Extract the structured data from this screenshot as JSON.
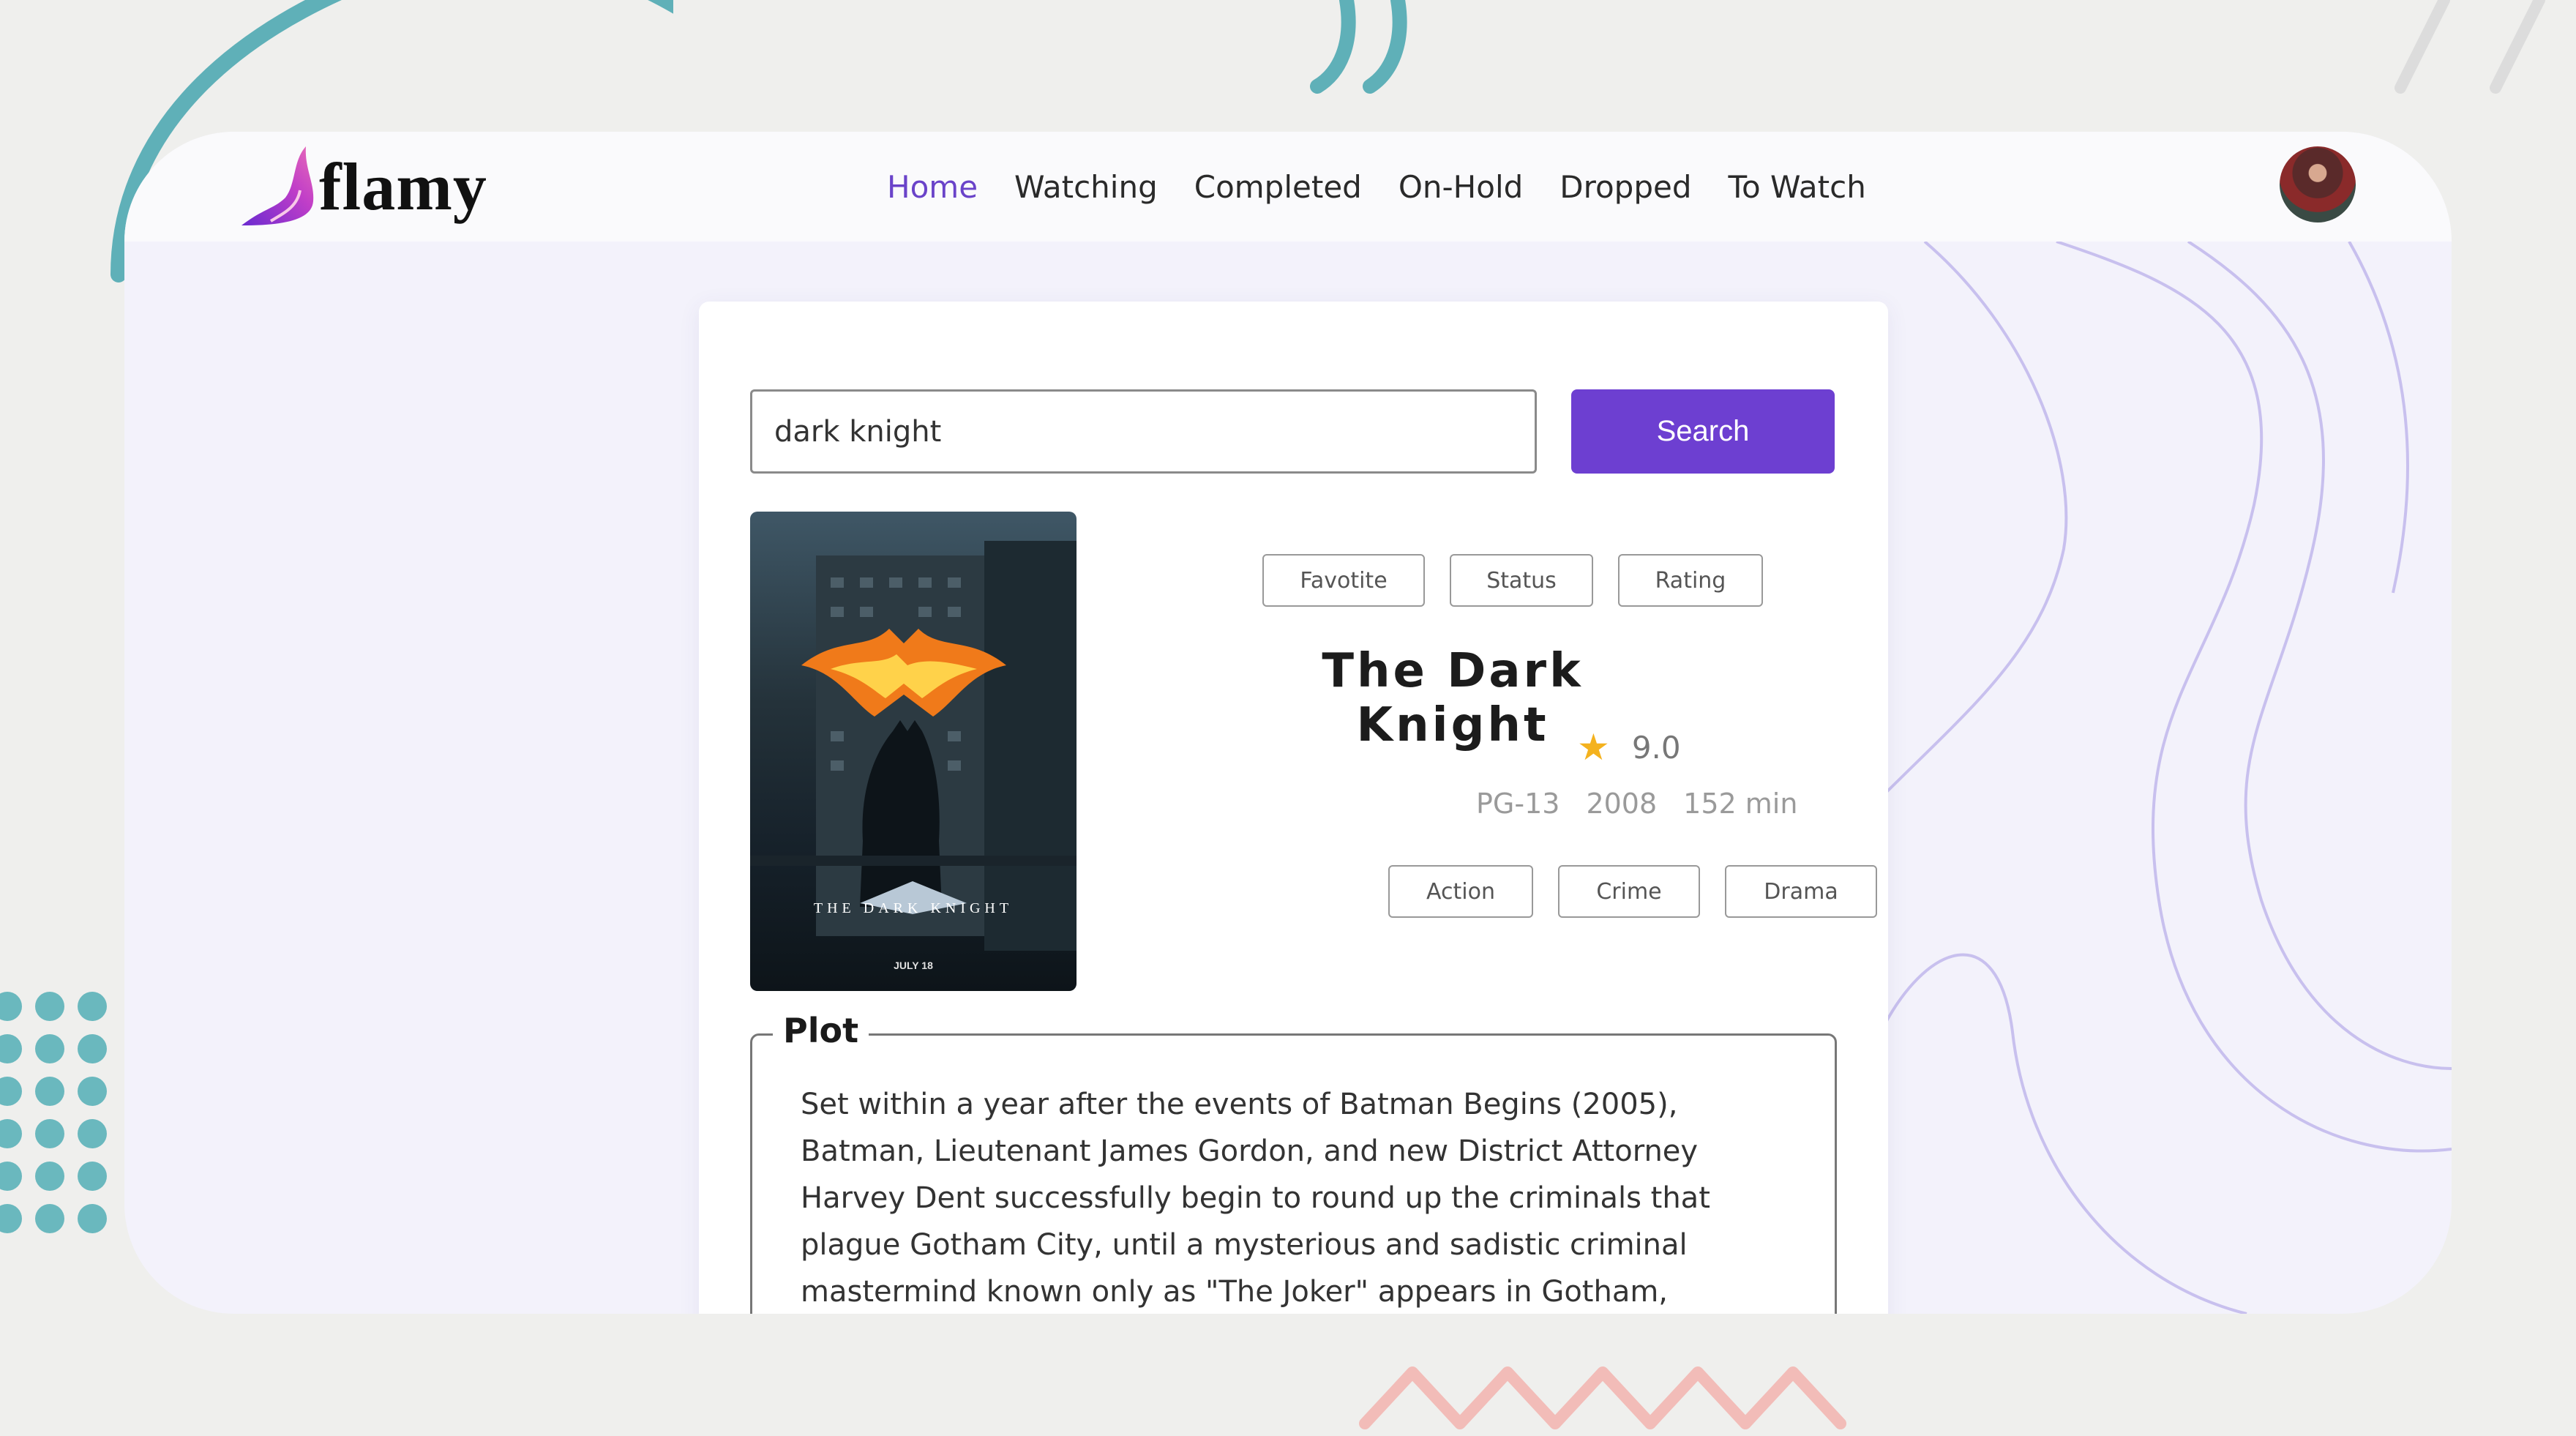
{
  "app": {
    "logo_text": "flamy"
  },
  "nav": {
    "items": [
      {
        "label": "Home",
        "active": true
      },
      {
        "label": "Watching"
      },
      {
        "label": "Completed"
      },
      {
        "label": "On-Hold"
      },
      {
        "label": "Dropped"
      },
      {
        "label": "To Watch"
      }
    ]
  },
  "search": {
    "value": "dark knight",
    "button_label": "Search"
  },
  "actions": {
    "favorite": "Favotite",
    "status": "Status",
    "rating": "Rating"
  },
  "movie": {
    "title": "The Dark Knight",
    "rating": "9.0",
    "rated": "PG-13",
    "year": "2008",
    "runtime": "152 min",
    "genres": [
      "Action",
      "Crime",
      "Drama"
    ],
    "plot_label": "Plot",
    "plot": "Set within a year after the events of Batman Begins (2005), Batman, Lieutenant James Gordon, and new District Attorney Harvey Dent successfully begin to round up the criminals that plague Gotham City, until a mysterious and sadistic criminal mastermind known only as \"The Joker\" appears in Gotham,"
  },
  "colors": {
    "accent": "#6d3fd1",
    "active_nav": "#6a43c9",
    "star": "#f4b21e",
    "teal": "#6ab8be",
    "zigzag": "#f0b9b6"
  },
  "icons": {
    "rating": "star-icon",
    "user": "avatar"
  }
}
